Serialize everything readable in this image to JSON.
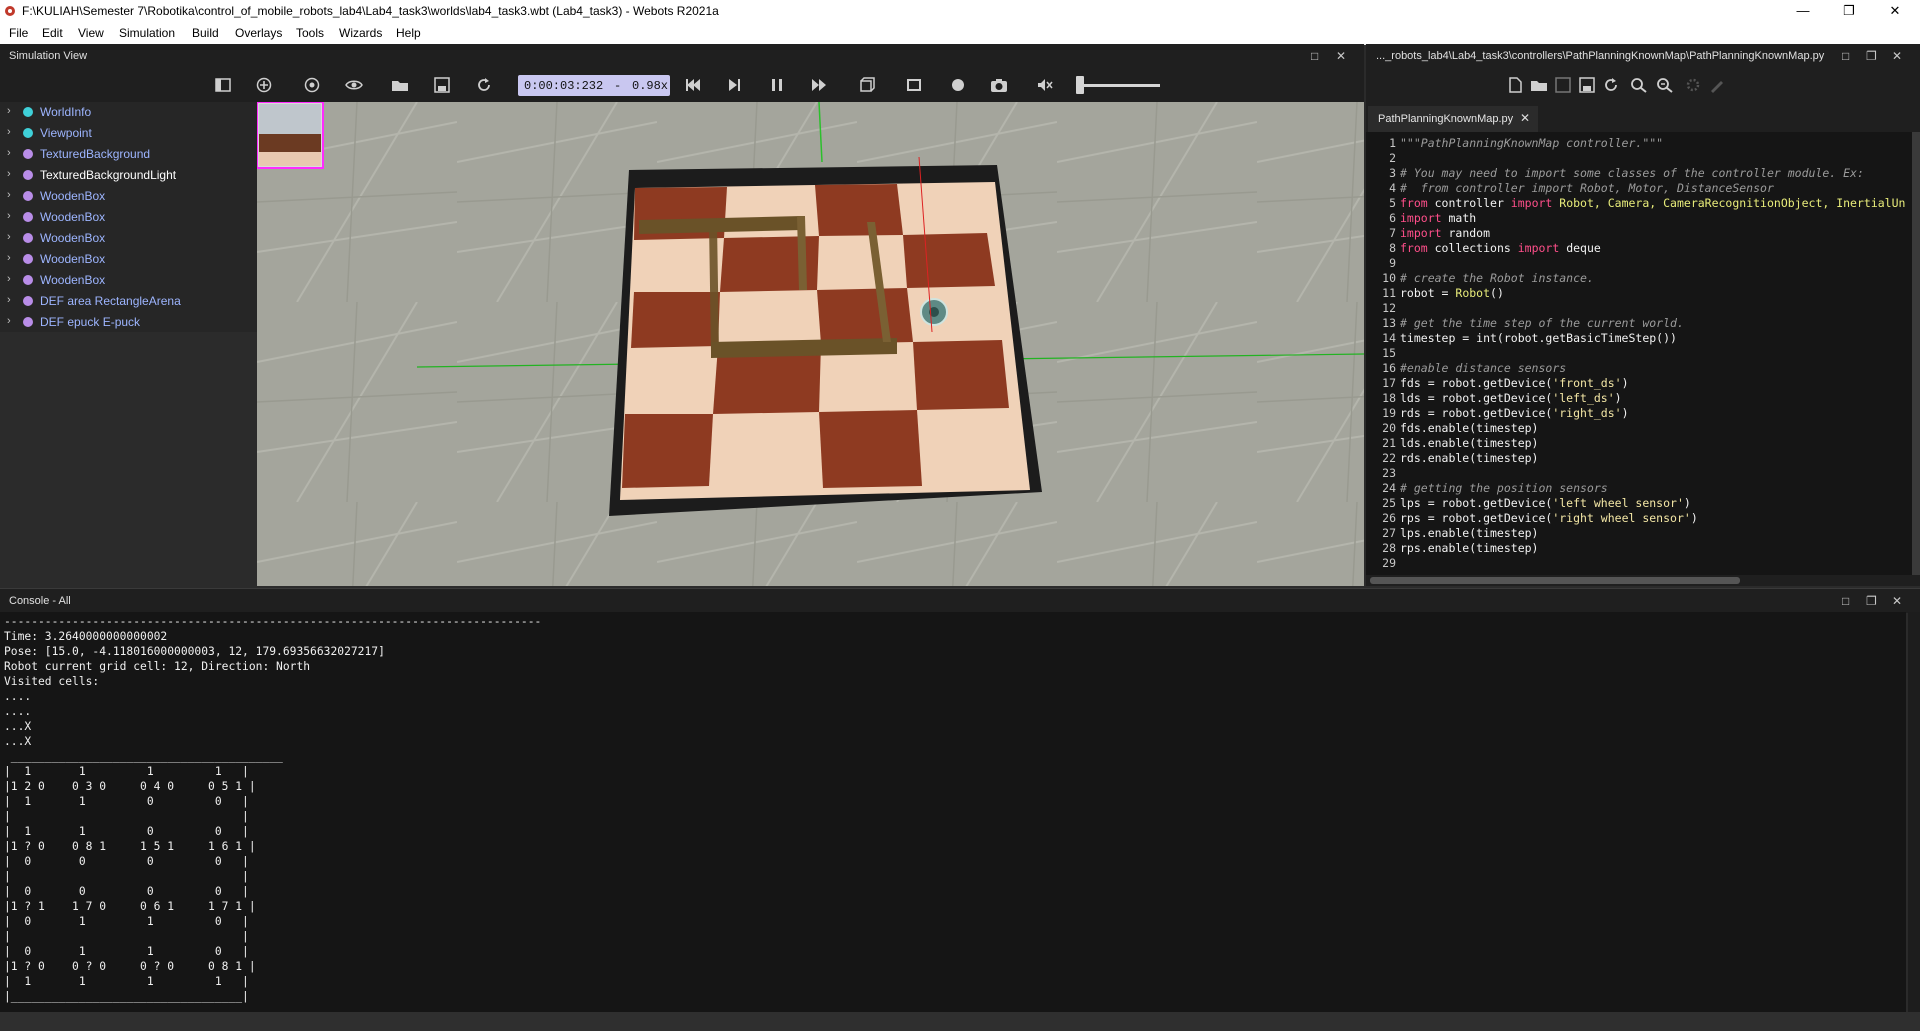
{
  "window": {
    "title": "F:\\KULIAH\\Semester 7\\Robotika\\control_of_mobile_robots_lab4\\Lab4_task3\\worlds\\lab4_task3.wbt (Lab4_task3) - Webots R2021a",
    "minimize": "—",
    "maximize": "❐",
    "close": "✕"
  },
  "menu": [
    "File",
    "Edit",
    "View",
    "Simulation",
    "Build",
    "Overlays",
    "Tools",
    "Wizards",
    "Help"
  ],
  "simulation_view": {
    "title": "Simulation View",
    "time": "0:00:03:232",
    "separator": "-",
    "speed": "0.98x"
  },
  "scene_tree": [
    {
      "label": "WorldInfo",
      "color": "#3fd0d8"
    },
    {
      "label": "Viewpoint",
      "color": "#3fd0d8"
    },
    {
      "label": "TexturedBackground",
      "color": "#b98de8"
    },
    {
      "label": "TexturedBackgroundLight",
      "color": "#b98de8"
    },
    {
      "label": "WoodenBox",
      "color": "#b98de8"
    },
    {
      "label": "WoodenBox",
      "color": "#b98de8"
    },
    {
      "label": "WoodenBox",
      "color": "#b98de8"
    },
    {
      "label": "WoodenBox",
      "color": "#b98de8"
    },
    {
      "label": "WoodenBox",
      "color": "#b98de8"
    },
    {
      "label": "DEF area RectangleArena",
      "color": "#b98de8"
    },
    {
      "label": "DEF epuck E-puck",
      "color": "#b98de8"
    }
  ],
  "editor": {
    "path": "..._robots_lab4\\Lab4_task3\\controllers\\PathPlanningKnownMap\\PathPlanningKnownMap.py",
    "tab": "PathPlanningKnownMap.py",
    "tab_close": "✕",
    "lines": [
      {
        "n": "1",
        "parts": [
          {
            "t": "\"\"\"PathPlanningKnownMap controller.\"\"\"",
            "c": "cm"
          }
        ]
      },
      {
        "n": "2",
        "parts": []
      },
      {
        "n": "3",
        "parts": [
          {
            "t": "# You may need to import some classes of the controller module. Ex:",
            "c": "cm"
          }
        ]
      },
      {
        "n": "4",
        "parts": [
          {
            "t": "#  from controller import Robot, Motor, DistanceSensor",
            "c": "cm"
          }
        ]
      },
      {
        "n": "5",
        "parts": [
          {
            "t": "from",
            "c": "kw"
          },
          {
            "t": " controller ",
            "c": "pl"
          },
          {
            "t": "import",
            "c": "kw"
          },
          {
            "t": " Robot, Camera, CameraRecognitionObject, InertialUn",
            "c": "cl"
          }
        ]
      },
      {
        "n": "6",
        "parts": [
          {
            "t": "import",
            "c": "kw"
          },
          {
            "t": " math",
            "c": "pl"
          }
        ]
      },
      {
        "n": "7",
        "parts": [
          {
            "t": "import",
            "c": "kw"
          },
          {
            "t": " random",
            "c": "pl"
          }
        ]
      },
      {
        "n": "8",
        "parts": [
          {
            "t": "from",
            "c": "kw"
          },
          {
            "t": " collections ",
            "c": "pl"
          },
          {
            "t": "import",
            "c": "kw"
          },
          {
            "t": " deque",
            "c": "pl"
          }
        ]
      },
      {
        "n": "9",
        "parts": []
      },
      {
        "n": "10",
        "parts": [
          {
            "t": "# create the Robot instance.",
            "c": "cm"
          }
        ]
      },
      {
        "n": "11",
        "parts": [
          {
            "t": "robot = ",
            "c": "pl"
          },
          {
            "t": "Robot",
            "c": "cl"
          },
          {
            "t": "()",
            "c": "pl"
          }
        ]
      },
      {
        "n": "12",
        "parts": []
      },
      {
        "n": "13",
        "parts": [
          {
            "t": "# get the time step of the current world.",
            "c": "cm"
          }
        ]
      },
      {
        "n": "14",
        "parts": [
          {
            "t": "timestep = int(robot.getBasicTimeStep())",
            "c": "pl"
          }
        ]
      },
      {
        "n": "15",
        "parts": []
      },
      {
        "n": "16",
        "parts": [
          {
            "t": "#enable distance sensors",
            "c": "cm"
          }
        ]
      },
      {
        "n": "17",
        "parts": [
          {
            "t": "fds = robot.getDevice(",
            "c": "pl"
          },
          {
            "t": "'front_ds'",
            "c": "st"
          },
          {
            "t": ")",
            "c": "pl"
          }
        ]
      },
      {
        "n": "18",
        "parts": [
          {
            "t": "lds = robot.getDevice(",
            "c": "pl"
          },
          {
            "t": "'left_ds'",
            "c": "st"
          },
          {
            "t": ")",
            "c": "pl"
          }
        ]
      },
      {
        "n": "19",
        "parts": [
          {
            "t": "rds = robot.getDevice(",
            "c": "pl"
          },
          {
            "t": "'right_ds'",
            "c": "st"
          },
          {
            "t": ")",
            "c": "pl"
          }
        ]
      },
      {
        "n": "20",
        "parts": [
          {
            "t": "fds.enable(timestep)",
            "c": "pl"
          }
        ]
      },
      {
        "n": "21",
        "parts": [
          {
            "t": "lds.enable(timestep)",
            "c": "pl"
          }
        ]
      },
      {
        "n": "22",
        "parts": [
          {
            "t": "rds.enable(timestep)",
            "c": "pl"
          }
        ]
      },
      {
        "n": "23",
        "parts": []
      },
      {
        "n": "24",
        "parts": [
          {
            "t": "# getting the position sensors",
            "c": "cm"
          }
        ]
      },
      {
        "n": "25",
        "parts": [
          {
            "t": "lps = robot.getDevice(",
            "c": "pl"
          },
          {
            "t": "'left wheel sensor'",
            "c": "st"
          },
          {
            "t": ")",
            "c": "pl"
          }
        ]
      },
      {
        "n": "26",
        "parts": [
          {
            "t": "rps = robot.getDevice(",
            "c": "pl"
          },
          {
            "t": "'right wheel sensor'",
            "c": "st"
          },
          {
            "t": ")",
            "c": "pl"
          }
        ]
      },
      {
        "n": "27",
        "parts": [
          {
            "t": "lps.enable(timestep)",
            "c": "pl"
          }
        ]
      },
      {
        "n": "28",
        "parts": [
          {
            "t": "rps.enable(timestep)",
            "c": "pl"
          }
        ]
      },
      {
        "n": "29",
        "parts": []
      }
    ]
  },
  "console": {
    "title": "Console - All",
    "lines": [
      "-------------------------------------------------------------------------------",
      "Time: 3.2640000000000002",
      "Pose: [15.0, -4.118016000000003, 12, 179.69356632027217]",
      "Robot current grid cell: 12, Direction: North",
      "Visited cells:",
      "....",
      "....",
      "...X",
      "...X",
      " ________________________________________ ",
      "|  1       1         1         1   |",
      "|1 2 0    0 3 0     0 4 0     0 5 1 |",
      "|  1       1         0         0   |",
      "|                                  |",
      "|  1       1         0         0   |",
      "|1 ? 0    0 8 1     1 5 1     1 6 1 |",
      "|  0       0         0         0   |",
      "|                                  |",
      "|  0       0         0         0   |",
      "|1 ? 1    1 7 0     0 6 1     1 7 1 |",
      "|  0       1         1         0   |",
      "|                                  |",
      "|  0       1         1         0   |",
      "|1 ? 0    0 ? 0     0 ? 0     0 8 1 |",
      "|  1       1         1         1   |",
      "|__________________________________|"
    ]
  },
  "icons": {
    "panel_maximize": "□",
    "panel_float": "❐",
    "panel_close": "✕"
  }
}
